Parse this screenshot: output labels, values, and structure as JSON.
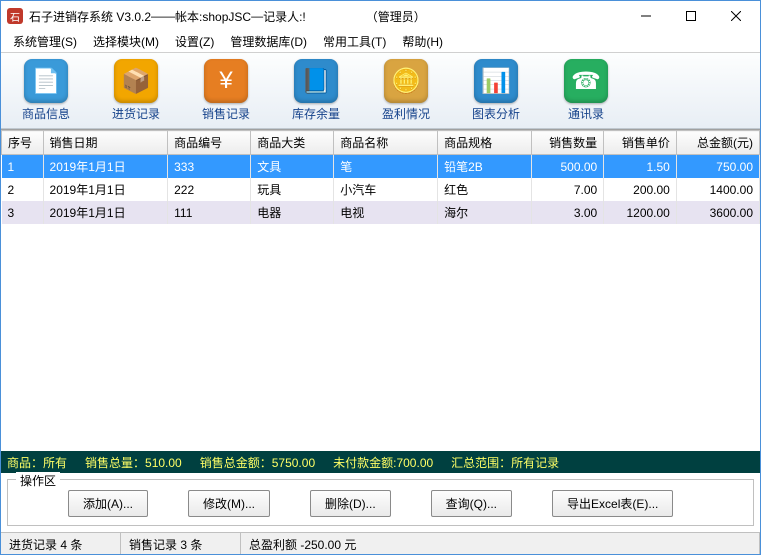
{
  "window": {
    "app_name": "石子进销存系统 V3.0.2",
    "sep1": " —— ",
    "account_label": "帐本:shopJSC",
    "sep2": " — ",
    "recorder_label": "记录人:!",
    "role": "（管理员）"
  },
  "menu": [
    "系统管理(S)",
    "选择模块(M)",
    "设置(Z)",
    "管理数据库(D)",
    "常用工具(T)",
    "帮助(H)"
  ],
  "toolbar": [
    {
      "label": "商品信息",
      "color": "#3a9ad9",
      "emoji": "📄"
    },
    {
      "label": "进货记录",
      "color": "#f2a600",
      "emoji": "📦"
    },
    {
      "label": "销售记录",
      "color": "#e67e22",
      "emoji": "¥"
    },
    {
      "label": "库存余量",
      "color": "#2e8bcc",
      "emoji": "📘"
    },
    {
      "label": "盈利情况",
      "color": "#d9a441",
      "emoji": "🪙"
    },
    {
      "label": "图表分析",
      "color": "#2e8bcc",
      "emoji": "📊"
    },
    {
      "label": "通讯录",
      "color": "#27ae60",
      "emoji": "☎"
    }
  ],
  "grid": {
    "headers": [
      "序号",
      "销售日期",
      "商品编号",
      "商品大类",
      "商品名称",
      "商品规格",
      "销售数量",
      "销售单价",
      "总金额(元)"
    ],
    "rows": [
      {
        "no": "1",
        "date": "2019年1月1日",
        "code": "333",
        "cat": "文具",
        "name": "笔",
        "spec": "铅笔2B",
        "qty": "500.00",
        "price": "1.50",
        "total": "750.00",
        "sel": true
      },
      {
        "no": "2",
        "date": "2019年1月1日",
        "code": "222",
        "cat": "玩具",
        "name": "小汽车",
        "spec": "红色",
        "qty": "7.00",
        "price": "200.00",
        "total": "1400.00"
      },
      {
        "no": "3",
        "date": "2019年1月1日",
        "code": "111",
        "cat": "电器",
        "name": "电视",
        "spec": "海尔",
        "qty": "3.00",
        "price": "1200.00",
        "total": "3600.00",
        "alt": true
      }
    ]
  },
  "summary": {
    "product": "商品：所有",
    "qty": "销售总量：510.00",
    "amount": "销售总金额：5750.00",
    "unpaid": "未付款金额:700.00",
    "scope": "汇总范围：所有记录"
  },
  "ops": {
    "legend": "操作区",
    "buttons": [
      "添加(A)...",
      "修改(M)...",
      "删除(D)...",
      "查询(Q)...",
      "导出Excel表(E)..."
    ]
  },
  "status": {
    "in": "进货记录 4 条",
    "out": "销售记录 3 条",
    "profit": "总盈利额 -250.00 元"
  },
  "chart_data": {
    "type": "table",
    "title": "销售记录",
    "headers": [
      "序号",
      "销售日期",
      "商品编号",
      "商品大类",
      "商品名称",
      "商品规格",
      "销售数量",
      "销售单价",
      "总金额(元)"
    ],
    "rows": [
      [
        "1",
        "2019年1月1日",
        "333",
        "文具",
        "笔",
        "铅笔2B",
        500.0,
        1.5,
        750.0
      ],
      [
        "2",
        "2019年1月1日",
        "222",
        "玩具",
        "小汽车",
        "红色",
        7.0,
        200.0,
        1400.0
      ],
      [
        "3",
        "2019年1月1日",
        "111",
        "电器",
        "电视",
        "海尔",
        3.0,
        1200.0,
        3600.0
      ]
    ],
    "totals": {
      "qty": 510.0,
      "amount": 5750.0,
      "unpaid": 700.0,
      "profit": -250.0
    }
  }
}
